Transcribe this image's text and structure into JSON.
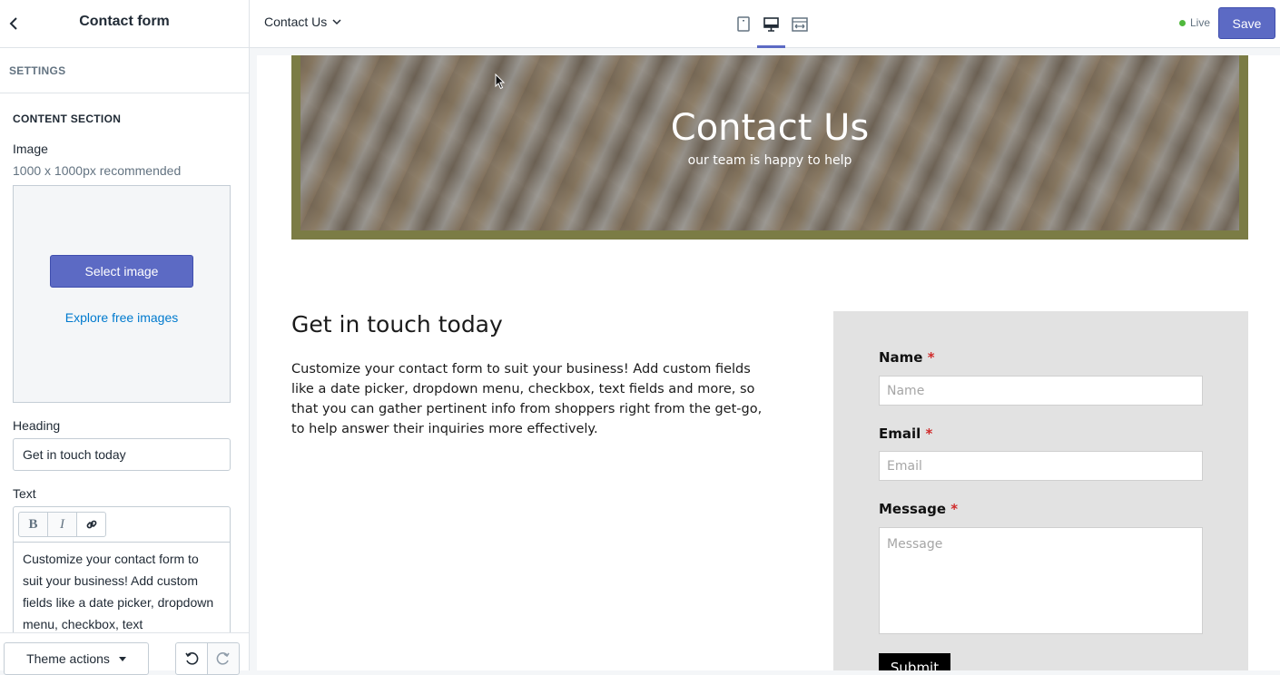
{
  "sidebar": {
    "title": "Contact form",
    "settings_label": "SETTINGS",
    "section_title": "CONTENT SECTION",
    "image_label": "Image",
    "image_hint": "1000 x 1000px recommended",
    "select_image": "Select image",
    "explore_images": "Explore free images",
    "heading_label": "Heading",
    "heading_value": "Get in touch today",
    "text_label": "Text",
    "text_value": "Customize your contact form to suit your business! Add custom fields like a date picker, dropdown menu, checkbox, text",
    "toolbar": {
      "bold": "B",
      "italic": "I"
    },
    "theme_actions": "Theme actions"
  },
  "topbar": {
    "page": "Contact Us",
    "live": "Live",
    "save": "Save"
  },
  "preview": {
    "hero_title": "Contact Us",
    "hero_subtitle": "our team is happy to help",
    "heading": "Get in touch today",
    "body": "Customize your contact form to suit your business! Add custom fields like a date picker, dropdown menu, checkbox, text fields and more, so that you can gather pertinent info from shoppers right from the get-go, to help answer their inquiries more effectively.",
    "form": {
      "name_label": "Name",
      "name_placeholder": "Name",
      "email_label": "Email",
      "email_placeholder": "Email",
      "message_label": "Message",
      "message_placeholder": "Message",
      "required_mark": "*",
      "submit": "Submit"
    }
  },
  "colors": {
    "accent": "#5c6ac4",
    "live": "#50b83c",
    "hero_border": "#7b7c45",
    "form_bg": "#e2e2e2",
    "required": "#d02b2b"
  }
}
